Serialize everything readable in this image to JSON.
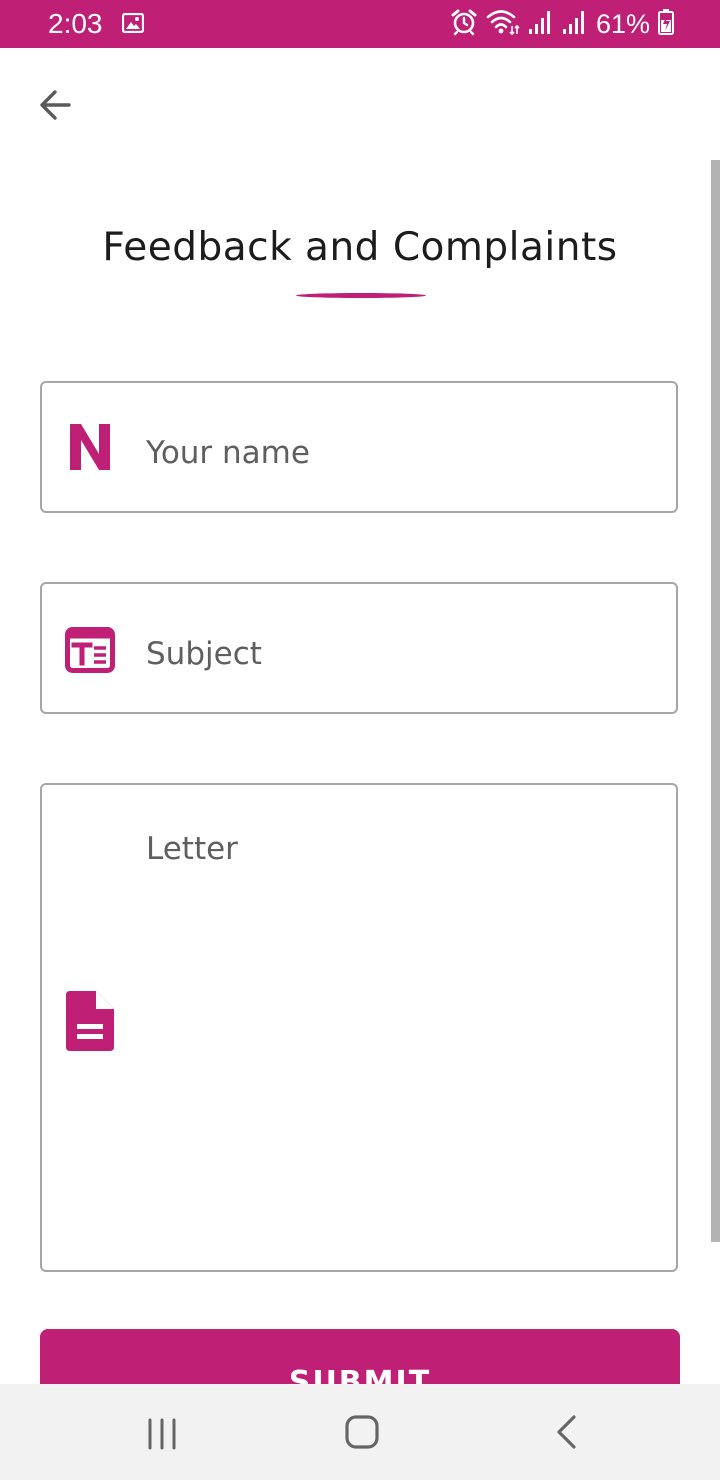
{
  "status_bar": {
    "time": "2:03",
    "battery": "61%",
    "background": "#c01f76"
  },
  "header": {
    "back_icon": "arrow-left-icon"
  },
  "page": {
    "title": "Feedback and Complaints"
  },
  "form": {
    "name_placeholder": "Your name",
    "subject_placeholder": "Subject",
    "letter_placeholder": "Letter",
    "name_icon": "letter-n-icon",
    "subject_icon": "subject-card-icon",
    "letter_icon": "document-icon"
  },
  "actions": {
    "submit_label": "SUBMIT"
  },
  "nav_bar": {
    "recents_icon": "recents-icon",
    "home_icon": "home-icon",
    "back_icon": "back-chevron-icon"
  },
  "colors": {
    "accent": "#c01f76",
    "border": "#a6a6a6",
    "placeholder": "#5f5f5f"
  }
}
